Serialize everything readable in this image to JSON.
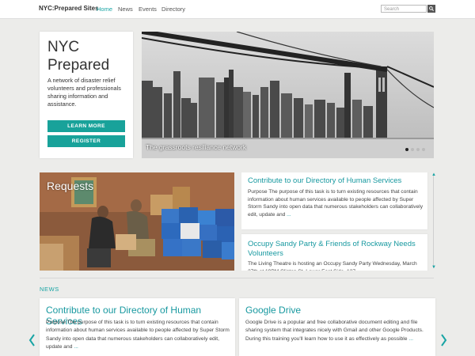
{
  "header": {
    "brand": "NYC:Prepared Sites",
    "nav": [
      "Home",
      "News",
      "Events",
      "Directory"
    ],
    "active_nav": "Home",
    "search_placeholder": "Search"
  },
  "hero": {
    "title_line1": "NYC",
    "title_line2": "Prepared",
    "description": "A network of disaster relief volunteers and professionals sharing information and assistance.",
    "learn_more": "LEARN MORE",
    "register": "REGISTER",
    "caption": "The grassroots resiliance network",
    "slide_count": 4,
    "active_slide": 1
  },
  "requests": {
    "label": "Requests",
    "items": [
      {
        "title": "Contribute to our Directory of Human Services",
        "body": "Purpose The purpose of this task is to turn existing resources that contain information about human services available to people affected by Super Storm Sandy into open data that numerous stakeholders can collaboratively edit, update and",
        "more": "..."
      },
      {
        "title": "Occupy Sandy Party & Friends of Rockway Needs Volunteers",
        "body": "The Living Theatre is hosting an Occupy Sandy Party Wednesday, March 27th at 19PM Clinton St. Lower East Side, 127"
      }
    ]
  },
  "news": {
    "heading": "NEWS",
    "items": [
      {
        "title": "Contribute to our Directory of Human Services",
        "body": "Purpose The purpose of this task is to turn existing resources that contain information about human services available to people affected by Super Storm Sandy into open data that numerous stakeholders can collaboratively edit, update and",
        "more": "..."
      },
      {
        "title": "Google Drive",
        "body": "Google Drive is a popular and free collaborative document editing and file sharing system that integrates nicely with Gmail and other Google Products. During this training you'll learn how to use it as effectively as possible",
        "more": "..."
      }
    ]
  },
  "colors": {
    "accent": "#18a29a",
    "link": "#1899a0"
  },
  "icons": {
    "search": "search-icon",
    "prev": "chevron-left-icon",
    "next": "chevron-right-icon"
  }
}
